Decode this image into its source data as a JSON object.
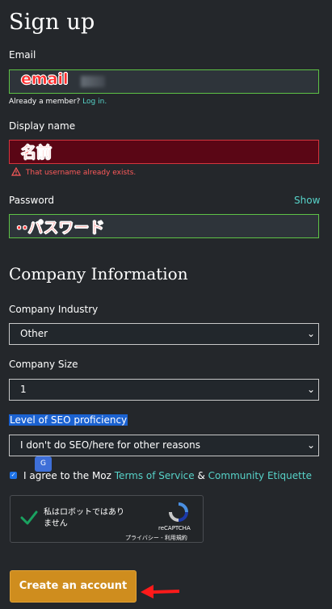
{
  "page": {
    "title": "Sign up",
    "company_heading": "Company Information"
  },
  "email": {
    "label": "Email",
    "value": "email",
    "already_member": "Already a member?",
    "login_link": "Log in."
  },
  "display_name": {
    "label": "Display name",
    "value": "名前",
    "error": "That username already exists."
  },
  "password": {
    "label": "Password",
    "show_link": "Show",
    "value": "··パスワード"
  },
  "company": {
    "industry": {
      "label": "Company Industry",
      "selected": "Other"
    },
    "size": {
      "label": "Company Size",
      "selected": "1"
    },
    "seo": {
      "label": "Level of SEO proficiency",
      "selected": "I don't do SEO/here for other reasons"
    }
  },
  "agree": {
    "prefix": "I agree to the Moz",
    "terms_link": "Terms of Service",
    "amp": "&",
    "etiquette_link": "Community Etiquette"
  },
  "captcha": {
    "line1": "私はロボットではあり",
    "line2": "ません",
    "brand": "reCAPTCHA",
    "privacy": "プライバシー - 利用規約"
  },
  "submit_label": "Create an account",
  "colors": {
    "background": "#24272b",
    "accent_link": "#57d3c9",
    "button": "#cf8d1e",
    "error": "#d4343d",
    "valid_border": "#5ec246"
  },
  "icons": [
    "warning-icon",
    "chevron-down-icon",
    "checkmark-icon",
    "recaptcha-logo-icon",
    "translate-icon",
    "red-arrow-icon"
  ]
}
